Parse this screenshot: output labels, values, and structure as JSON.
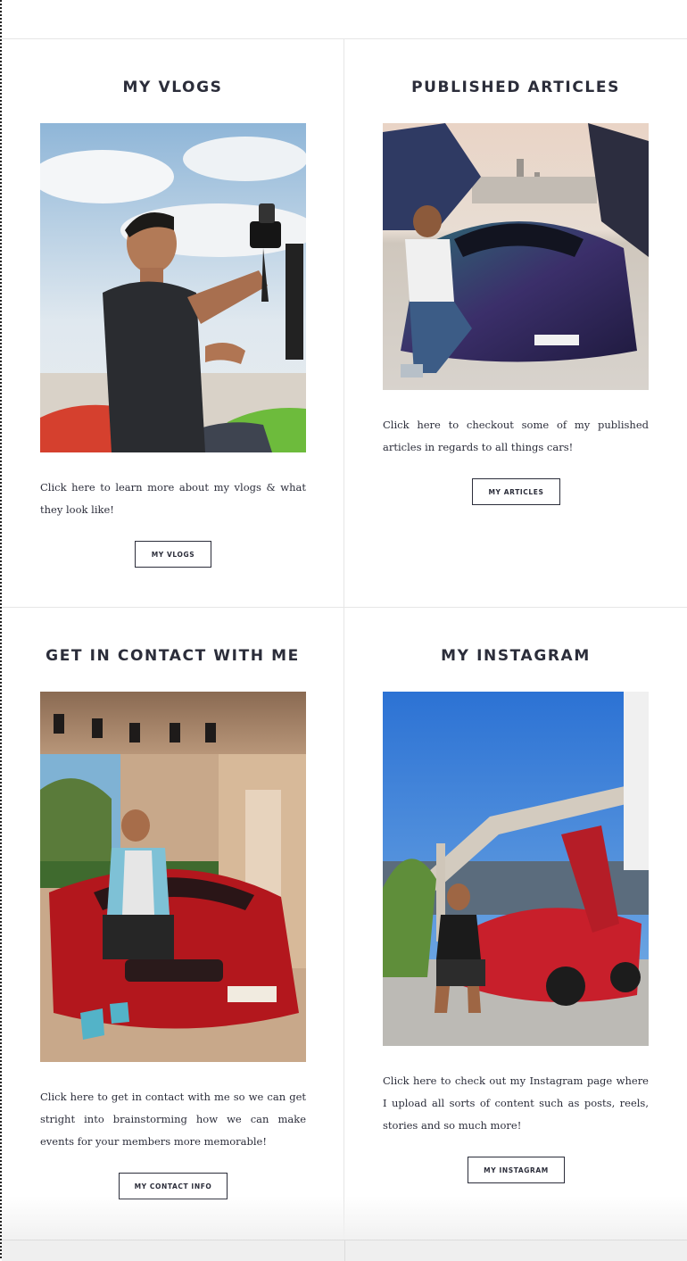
{
  "sections": [
    {
      "title": "MY VLOGS",
      "image": "vlogger-with-camera-photo",
      "description": "Click here to learn more about my vlogs & what they look like!",
      "button_label": "MY VLOGS"
    },
    {
      "title": "PUBLISHED ARTICLES",
      "image": "man-with-purple-supercar-photo",
      "description": "Click here to checkout some of my published articles in regards to all things cars!",
      "button_label": "MY ARTICLES"
    },
    {
      "title": "GET IN CONTACT WITH ME",
      "image": "man-on-red-mustang-photo",
      "description": "Click here to get in contact with me so we can get stright into brainstorming how we can make events for your members more memorable!",
      "button_label": "MY CONTACT INFO"
    },
    {
      "title": "MY INSTAGRAM",
      "image": "man-with-red-supercar-photo",
      "description": "Click here to check out my Instagram page where I upload all sorts of content such as posts, reels, stories and so much more!",
      "button_label": "MY INSTAGRAM"
    }
  ],
  "colors": {
    "text": "#2b2d3a",
    "divider": "#e6e6e6",
    "background": "#ffffff"
  }
}
